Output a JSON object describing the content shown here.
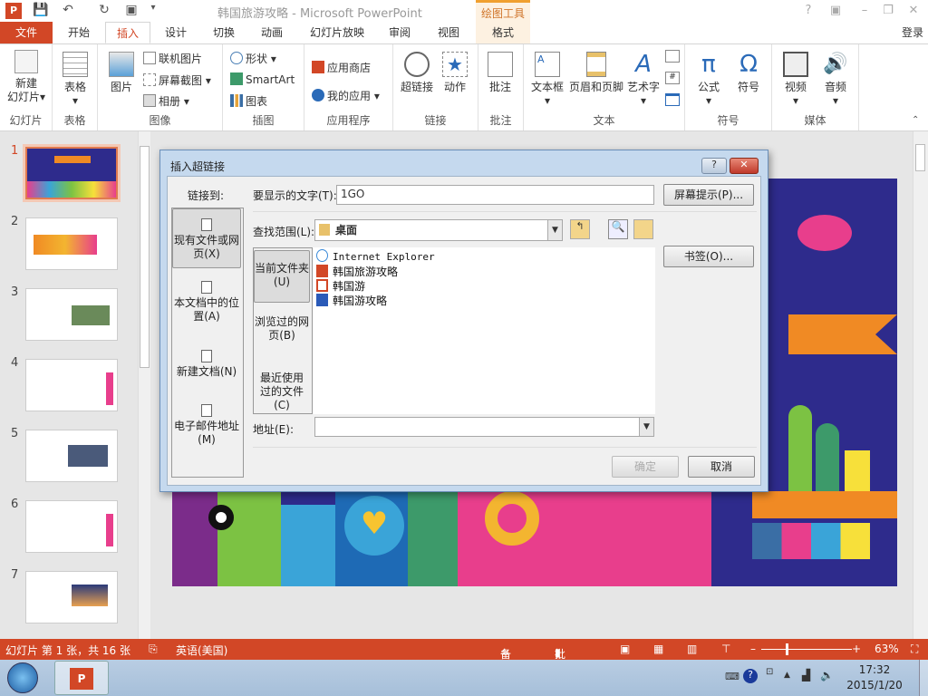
{
  "window": {
    "title": "韩国旅游攻略 - Microsoft PowerPoint",
    "contextual_tab": "绘图工具",
    "sign_in": "登录"
  },
  "tabs": [
    "文件",
    "开始",
    "插入",
    "设计",
    "切换",
    "动画",
    "幻灯片放映",
    "审阅",
    "视图",
    "格式"
  ],
  "active_tab": "插入",
  "ribbon": {
    "groups": [
      {
        "label": "幻灯片",
        "items": [
          "新建\n幻灯片"
        ]
      },
      {
        "label": "表格",
        "items": [
          "表格"
        ]
      },
      {
        "label": "图像",
        "items": [
          "图片",
          "联机图片",
          "屏幕截图",
          "相册"
        ]
      },
      {
        "label": "插图",
        "items": [
          "形状",
          "SmartArt",
          "图表"
        ]
      },
      {
        "label": "应用程序",
        "items": [
          "应用商店",
          "我的应用"
        ]
      },
      {
        "label": "链接",
        "items": [
          "超链接",
          "动作"
        ]
      },
      {
        "label": "批注",
        "items": [
          "批注"
        ]
      },
      {
        "label": "文本",
        "items": [
          "文本框",
          "页眉和页脚",
          "艺术字"
        ]
      },
      {
        "label": "符号",
        "items": [
          "公式",
          "符号"
        ]
      },
      {
        "label": "媒体",
        "items": [
          "视频",
          "音频"
        ]
      }
    ],
    "new_slide_line1": "新建",
    "new_slide_line2": "幻灯片"
  },
  "thumbnails": [
    "1",
    "2",
    "3",
    "4",
    "5",
    "6",
    "7"
  ],
  "dialog": {
    "title": "插入超链接",
    "link_to_label": "链接到:",
    "link_to": [
      "现有文件或网页(X)",
      "本文档中的位置(A)",
      "新建文档(N)",
      "电子邮件地址(M)"
    ],
    "display_text_label": "要显示的文字(T):",
    "display_text": "1GO",
    "screentip_button": "屏幕提示(P)...",
    "look_in_label": "查找范围(L):",
    "look_in": "桌面",
    "sub_nav": [
      "当前文件夹(U)",
      "浏览过的网页(B)",
      "最近使用过的文件(C)"
    ],
    "files": [
      {
        "name": "Internet Explorer",
        "type": "ie"
      },
      {
        "name": "韩国旅游攻略",
        "type": "pptx"
      },
      {
        "name": "韩国游",
        "type": "pps"
      },
      {
        "name": "韩国游攻略",
        "type": "docx"
      }
    ],
    "bookmark_button": "书签(O)...",
    "address_label": "地址(E):",
    "address": "",
    "ok_button": "确定",
    "cancel_button": "取消"
  },
  "status": {
    "slide_info": "幻灯片 第 1 张，共 16 张",
    "language": "英语(美国)",
    "notes": "备注",
    "comments": "批注",
    "zoom": "63%"
  },
  "taskbar": {
    "time": "17:32",
    "date": "2015/1/20"
  },
  "colors": {
    "accent": "#D24726",
    "slide_bg": "#2E2B8C"
  }
}
